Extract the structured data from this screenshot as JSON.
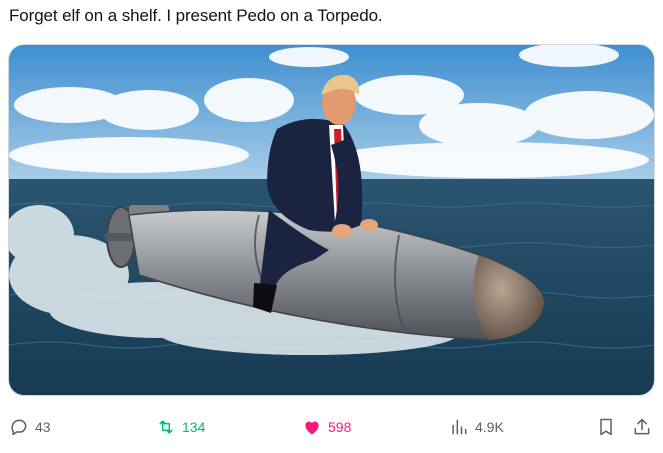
{
  "post": {
    "text": "Forget elf on a shelf. I present Pedo on a Torpedo."
  },
  "media": {
    "icon": "photo",
    "colors": {
      "sky": "#5b9fd6",
      "sea": "#1f4863",
      "suit": "#1a2340",
      "tie": "#d01c2a",
      "torpedo": "#8b8f93"
    }
  },
  "actions": {
    "reply": {
      "icon": "reply-icon",
      "count": "43"
    },
    "retweet": {
      "icon": "retweet-icon",
      "count": "134",
      "color": "#00ba7c"
    },
    "like": {
      "icon": "heart-icon",
      "count": "598",
      "color": "#f91880"
    },
    "views": {
      "icon": "views-icon",
      "count": "4.9K"
    },
    "bookmark": {
      "icon": "bookmark-icon"
    },
    "share": {
      "icon": "share-icon"
    }
  }
}
